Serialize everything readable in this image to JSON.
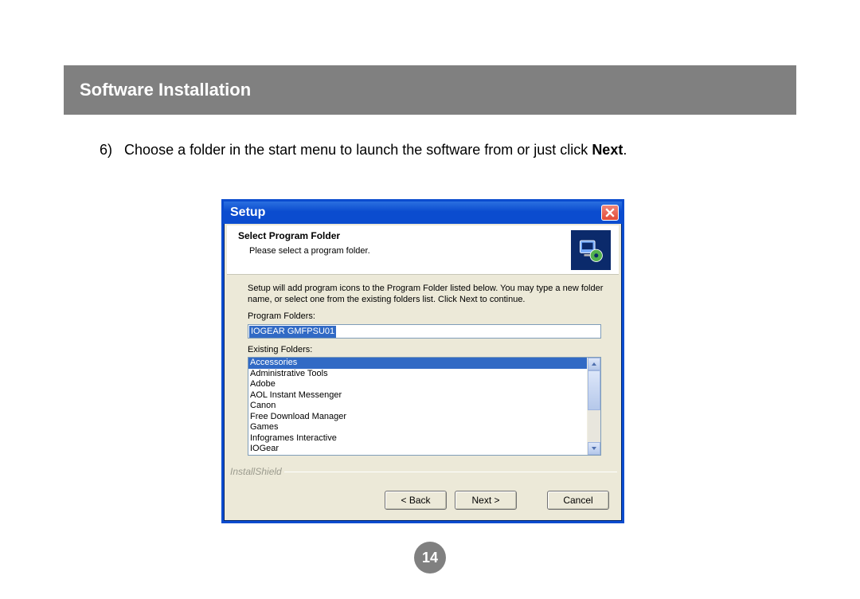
{
  "header": {
    "title": "Software Installation"
  },
  "instruction": {
    "number": "6)",
    "text_before": "Choose a folder in the start menu to launch the software from or just click ",
    "bold": "Next",
    "text_after": "."
  },
  "dialog": {
    "title": "Setup",
    "panel_title": "Select Program Folder",
    "panel_subtitle": "Please select a program folder.",
    "description": "Setup will add program icons to the Program Folder listed below.  You may type a new folder name, or select one from the existing folders list.  Click Next to continue.",
    "program_folders_label": "Program Folders:",
    "program_folder_value": "IOGEAR GMFPSU01",
    "existing_folders_label": "Existing Folders:",
    "existing_folders": [
      "Accessories",
      "Administrative Tools",
      "Adobe",
      "AOL Instant Messenger",
      "Canon",
      "Free Download Manager",
      "Games",
      "Infogrames Interactive",
      "IOGear"
    ],
    "branding": "InstallShield",
    "buttons": {
      "back": "< Back",
      "next": "Next >",
      "cancel": "Cancel"
    }
  },
  "page_number": "14"
}
